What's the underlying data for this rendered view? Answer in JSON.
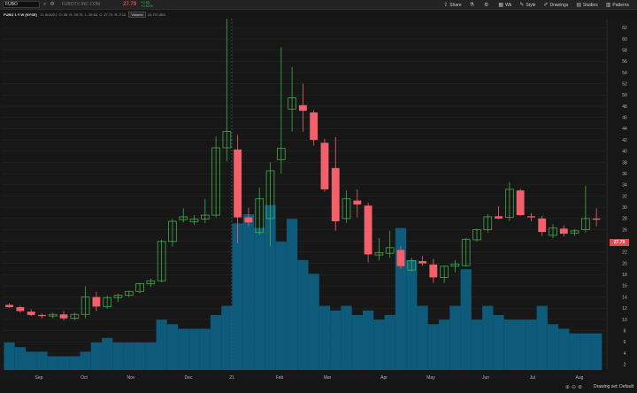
{
  "toolbar": {
    "symbol": "FUBO",
    "company": "FUBOTV INC COM",
    "last_price": "27.79",
    "change": "+0.55",
    "change_pct": "+2.02%",
    "buttons": [
      "Share",
      "Wk",
      "Style",
      "Drawings",
      "Studies",
      "Patterns"
    ],
    "icons": [
      "search-icon",
      "settings-icon",
      "share-icon",
      "flask-icon",
      "gear-icon",
      "calendar-icon",
      "brush-icon",
      "pencil-icon",
      "studies-icon",
      "patterns-icon"
    ]
  },
  "info": {
    "title": "FUBO 1 Y W (NYSE)",
    "date": "D: 8/16/21",
    "open": "O: 28",
    "high": "H: 29.75",
    "low": "L: 26.63",
    "close": "C: 27.79",
    "range": "R: 2.12",
    "volume_label": "Volume",
    "volume_value": "10,757,883"
  },
  "chart_data": {
    "type": "candlestick",
    "x_labels": [
      "Sep",
      "Oct",
      "Nov",
      "Dec",
      "21",
      "Feb",
      "Mar",
      "Apr",
      "May",
      "Jun",
      "Jul",
      "Aug"
    ],
    "y_ticks": [
      2,
      4,
      6,
      8,
      10,
      12,
      14,
      16,
      18,
      20,
      22,
      24,
      26,
      28,
      30,
      32,
      34,
      36,
      38,
      40,
      42,
      44,
      46,
      48,
      50,
      52,
      54,
      56,
      58,
      60,
      62
    ],
    "ylim": [
      1,
      63
    ],
    "colors": {
      "up": "#3fae4a",
      "down": "#f2616b",
      "volume": "#0d5a7a",
      "grid": "#2a2a2a"
    },
    "candles": [
      {
        "o": 12.6,
        "h": 12.9,
        "l": 12.1,
        "c": 12.2
      },
      {
        "o": 12.2,
        "h": 12.5,
        "l": 11.2,
        "c": 11.5
      },
      {
        "o": 11.4,
        "h": 11.8,
        "l": 10.6,
        "c": 10.8
      },
      {
        "o": 10.8,
        "h": 11.1,
        "l": 10.2,
        "c": 10.6
      },
      {
        "o": 10.6,
        "h": 11.2,
        "l": 10.2,
        "c": 10.9
      },
      {
        "o": 10.9,
        "h": 11.5,
        "l": 9.8,
        "c": 10.2
      },
      {
        "o": 10.2,
        "h": 11.2,
        "l": 9.9,
        "c": 10.9
      },
      {
        "o": 10.9,
        "h": 15.9,
        "l": 10.2,
        "c": 14.0
      },
      {
        "o": 14.0,
        "h": 14.9,
        "l": 11.5,
        "c": 12.3
      },
      {
        "o": 12.3,
        "h": 14.3,
        "l": 11.9,
        "c": 13.9
      },
      {
        "o": 13.9,
        "h": 14.6,
        "l": 13.1,
        "c": 14.3
      },
      {
        "o": 14.3,
        "h": 15.1,
        "l": 14.0,
        "c": 15.0
      },
      {
        "o": 15.0,
        "h": 16.5,
        "l": 14.7,
        "c": 16.4
      },
      {
        "o": 16.4,
        "h": 17.3,
        "l": 15.8,
        "c": 16.9
      },
      {
        "o": 16.9,
        "h": 24.2,
        "l": 16.6,
        "c": 23.9
      },
      {
        "o": 23.9,
        "h": 27.9,
        "l": 23.0,
        "c": 27.5
      },
      {
        "o": 27.8,
        "h": 29.8,
        "l": 27.3,
        "c": 28.3
      },
      {
        "o": 27.4,
        "h": 28.6,
        "l": 26.9,
        "c": 27.9
      },
      {
        "o": 27.9,
        "h": 31.5,
        "l": 27.2,
        "c": 28.6
      },
      {
        "o": 28.6,
        "h": 42.6,
        "l": 28.2,
        "c": 40.6
      },
      {
        "o": 40.6,
        "h": 63.6,
        "l": 38.2,
        "c": 43.5
      },
      {
        "o": 40.3,
        "h": 42.9,
        "l": 23.6,
        "c": 28.2
      },
      {
        "o": 28.2,
        "h": 29.9,
        "l": 26.6,
        "c": 27.3
      },
      {
        "o": 25.5,
        "h": 33.5,
        "l": 25.0,
        "c": 31.5
      },
      {
        "o": 28.0,
        "h": 38.0,
        "l": 23.0,
        "c": 36.5
      },
      {
        "o": 38.5,
        "h": 58.5,
        "l": 36.0,
        "c": 40.5
      },
      {
        "o": 47.5,
        "h": 55.0,
        "l": 43.5,
        "c": 49.5
      },
      {
        "o": 48.2,
        "h": 52.0,
        "l": 43.5,
        "c": 47.2
      },
      {
        "o": 46.9,
        "h": 47.3,
        "l": 41.0,
        "c": 42.0
      },
      {
        "o": 41.5,
        "h": 42.2,
        "l": 32.8,
        "c": 33.2
      },
      {
        "o": 37.0,
        "h": 42.5,
        "l": 25.8,
        "c": 27.5
      },
      {
        "o": 28.0,
        "h": 33.0,
        "l": 27.2,
        "c": 31.5
      },
      {
        "o": 31.2,
        "h": 33.2,
        "l": 28.2,
        "c": 30.5
      },
      {
        "o": 30.3,
        "h": 30.8,
        "l": 20.2,
        "c": 21.6
      },
      {
        "o": 21.5,
        "h": 24.5,
        "l": 20.5,
        "c": 21.9
      },
      {
        "o": 21.8,
        "h": 25.8,
        "l": 21.0,
        "c": 22.8
      },
      {
        "o": 22.4,
        "h": 23.1,
        "l": 19.0,
        "c": 19.5
      },
      {
        "o": 18.8,
        "h": 21.0,
        "l": 18.6,
        "c": 20.5
      },
      {
        "o": 20.4,
        "h": 21.3,
        "l": 19.6,
        "c": 20.0
      },
      {
        "o": 19.8,
        "h": 20.8,
        "l": 16.5,
        "c": 17.5
      },
      {
        "o": 17.5,
        "h": 19.6,
        "l": 16.5,
        "c": 19.5
      },
      {
        "o": 19.5,
        "h": 20.6,
        "l": 18.4,
        "c": 19.9
      },
      {
        "o": 19.6,
        "h": 24.5,
        "l": 19.4,
        "c": 24.3
      },
      {
        "o": 24.2,
        "h": 26.2,
        "l": 23.9,
        "c": 26.0
      },
      {
        "o": 26.0,
        "h": 28.8,
        "l": 25.5,
        "c": 28.3
      },
      {
        "o": 28.4,
        "h": 30.2,
        "l": 27.9,
        "c": 28.0
      },
      {
        "o": 28.2,
        "h": 34.5,
        "l": 27.6,
        "c": 33.2
      },
      {
        "o": 33.0,
        "h": 33.3,
        "l": 28.5,
        "c": 28.6
      },
      {
        "o": 28.4,
        "h": 29.0,
        "l": 27.5,
        "c": 28.2
      },
      {
        "o": 28.0,
        "h": 28.5,
        "l": 24.9,
        "c": 25.6
      },
      {
        "o": 25.0,
        "h": 27.0,
        "l": 24.5,
        "c": 26.3
      },
      {
        "o": 26.2,
        "h": 26.8,
        "l": 24.8,
        "c": 25.3
      },
      {
        "o": 25.4,
        "h": 26.1,
        "l": 24.9,
        "c": 25.8
      },
      {
        "o": 26.0,
        "h": 33.8,
        "l": 25.5,
        "c": 28.0
      },
      {
        "o": 28.0,
        "h": 29.8,
        "l": 26.6,
        "c": 27.8
      }
    ],
    "volume": [
      6,
      5,
      4,
      4,
      3,
      3,
      3,
      4,
      6,
      7,
      6,
      6,
      6,
      6,
      11,
      10,
      9,
      9,
      9,
      12,
      14,
      32,
      34,
      31,
      36,
      28,
      33,
      24,
      21,
      14,
      13,
      14,
      12,
      13,
      11,
      12,
      31,
      24,
      14,
      10,
      11,
      14,
      22,
      11,
      14,
      12,
      11,
      11,
      11,
      14,
      10,
      9,
      8,
      8,
      8,
      17,
      3
    ],
    "last_price_tag": "27.79"
  },
  "status": {
    "drawing_set": "Drawing set: Default"
  }
}
